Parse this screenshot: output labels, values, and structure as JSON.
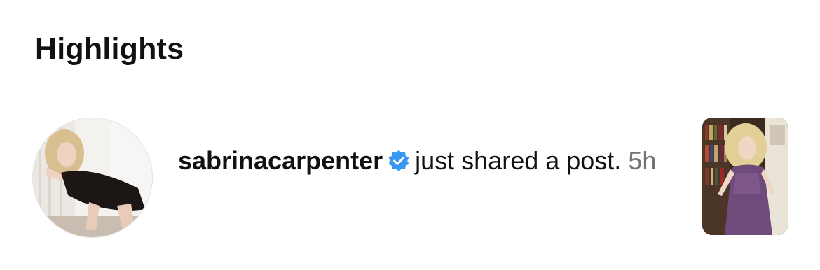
{
  "highlights": {
    "title": "Highlights"
  },
  "notification": {
    "username": "sabrinacarpenter",
    "verified_icon": "verified-badge-icon",
    "message": "just shared a post.",
    "time": "5h",
    "colors": {
      "verified": "#3897f0",
      "time": "#737373"
    }
  }
}
